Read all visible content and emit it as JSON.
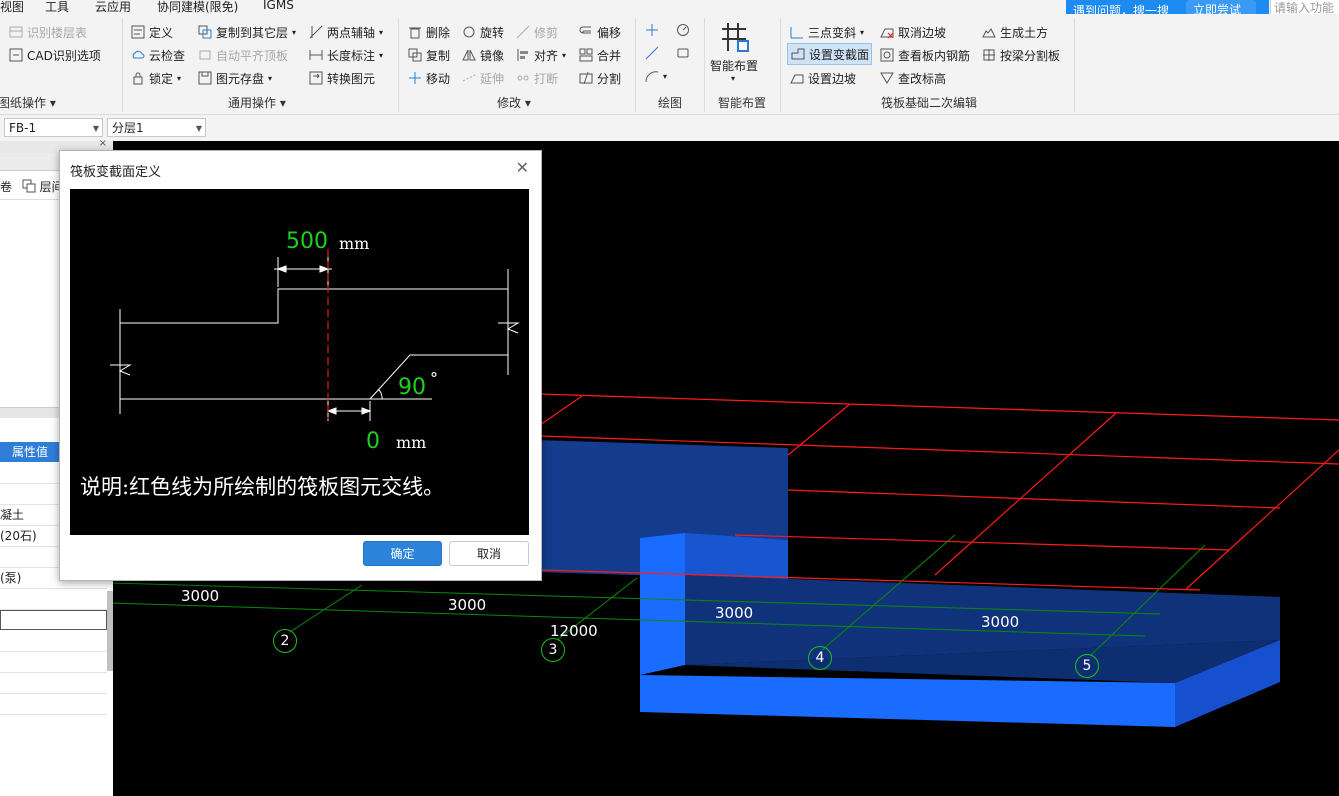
{
  "menu": {
    "items": [
      "视图",
      "工具",
      "云应用",
      "协同建模(限免)",
      "IGMS"
    ]
  },
  "tip": {
    "text": "遇到问题，搜一搜",
    "button": "立即尝试"
  },
  "command_input": {
    "placeholder": "请输入功能"
  },
  "ribbon": {
    "drawing_ops": {
      "recognize_floor_table": "识别楼层表",
      "cad_options": "CAD识别选项",
      "group_label": "图纸操作"
    },
    "common_ops": {
      "define": "定义",
      "copy_to_layer": "复制到其它层",
      "cloud_check": "云检查",
      "auto_align_top": "自动平齐顶板",
      "lock": "锁定",
      "save_element": "图元存盘",
      "two_point_axis": "两点辅轴",
      "length_dim": "长度标注",
      "convert_element": "转换图元",
      "group_label": "通用操作"
    },
    "modify": {
      "delete": "删除",
      "rotate": "旋转",
      "trim": "修剪",
      "offset": "偏移",
      "copy": "复制",
      "mirror": "镜像",
      "align": "对齐",
      "merge": "合并",
      "move": "移动",
      "extend": "延伸",
      "break": "打断",
      "split": "分割",
      "group_label": "修改"
    },
    "draw": {
      "group_label": "绘图"
    },
    "smart_layout": {
      "label": "智能布置",
      "group_label": "智能布置"
    },
    "raft_edit": {
      "three_point_slope": "三点变斜",
      "cancel_side_slope": "取消边坡",
      "generate_earthwork": "生成土方",
      "set_variable_section": "设置变截面",
      "view_rebar": "查看板内钢筋",
      "split_by_beam": "按梁分割板",
      "set_side_slope": "设置边坡",
      "modify_elevation": "查改标高",
      "group_label": "筏板基础二次编辑"
    }
  },
  "toolbar2": {
    "element": "FB-1",
    "sublayer": "分层1"
  },
  "left_panel": {
    "tab_floor": "层间",
    "prop_header": "属性值",
    "rows": [
      "",
      "",
      "凝土",
      "(20石)",
      "",
      "(泵)",
      "",
      "",
      "",
      "",
      "",
      ""
    ]
  },
  "dialog": {
    "title": "筏板变截面定义",
    "top_value": "500",
    "top_unit": "mm",
    "angle_value": "90",
    "angle_unit": "°",
    "bottom_value": "0",
    "bottom_unit": "mm",
    "note": "说明:红色线为所绘制的筏板图元交线。",
    "ok": "确定",
    "cancel": "取消"
  },
  "viewport": {
    "dim_labels": [
      "3000",
      "3000",
      "3000",
      "3000",
      "12000"
    ],
    "axis_labels": [
      "2",
      "3",
      "4",
      "5"
    ]
  },
  "colors": {
    "accent": "#2b84d9",
    "slab_blue": "#1a6bff",
    "red_line": "#ff1a1a",
    "green_line": "#0a8a0a"
  }
}
